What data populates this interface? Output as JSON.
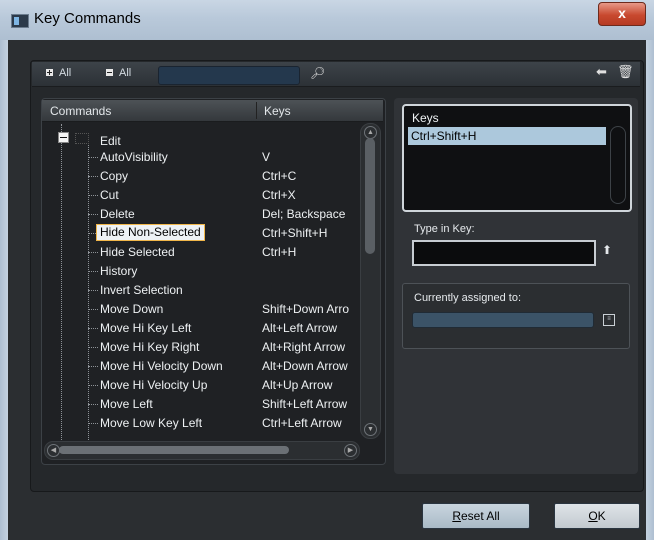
{
  "window": {
    "title": "Key Commands",
    "close_glyph": "x"
  },
  "toolbar": {
    "expand_all": "All",
    "collapse_all": "All",
    "search_placeholder": "",
    "search_icon": "binoculars-icon",
    "assign_icon": "arrow-left-icon",
    "delete_icon": "trash-icon"
  },
  "commands_table": {
    "headers": {
      "commands": "Commands",
      "keys": "Keys"
    },
    "category": "Edit",
    "rows": [
      {
        "command": "AutoVisibility",
        "keys": "V"
      },
      {
        "command": "Copy",
        "keys": "Ctrl+C"
      },
      {
        "command": "Cut",
        "keys": "Ctrl+X"
      },
      {
        "command": "Delete",
        "keys": "Del; Backspace"
      },
      {
        "command": "Hide Non-Selected",
        "keys": "Ctrl+Shift+H",
        "selected": true
      },
      {
        "command": "Hide Selected",
        "keys": "Ctrl+H"
      },
      {
        "command": "History",
        "keys": ""
      },
      {
        "command": "Invert Selection",
        "keys": ""
      },
      {
        "command": "Move Down",
        "keys": "Shift+Down Arro"
      },
      {
        "command": "Move Hi Key Left",
        "keys": "Alt+Left Arrow"
      },
      {
        "command": "Move Hi Key Right",
        "keys": "Alt+Right Arrow"
      },
      {
        "command": "Move Hi Velocity Down",
        "keys": "Alt+Down Arrow"
      },
      {
        "command": "Move Hi Velocity Up",
        "keys": "Alt+Up Arrow"
      },
      {
        "command": "Move Left",
        "keys": "Shift+Left Arrow"
      },
      {
        "command": "Move Low Key Left",
        "keys": "Ctrl+Left Arrow"
      }
    ]
  },
  "keys_panel": {
    "label": "Keys",
    "items": [
      "Ctrl+Shift+H"
    ]
  },
  "type_in_key": {
    "label": "Type in Key:",
    "value": ""
  },
  "currently_assigned": {
    "label": "Currently assigned to:",
    "value": ""
  },
  "buttons": {
    "reset_all_first": "R",
    "reset_all_rest": "eset All",
    "ok_first": "O",
    "ok_rest": "K"
  },
  "colors": {
    "accent": "#acc8dc",
    "selection_border": "#f0b64a",
    "close": "#c8492f"
  }
}
